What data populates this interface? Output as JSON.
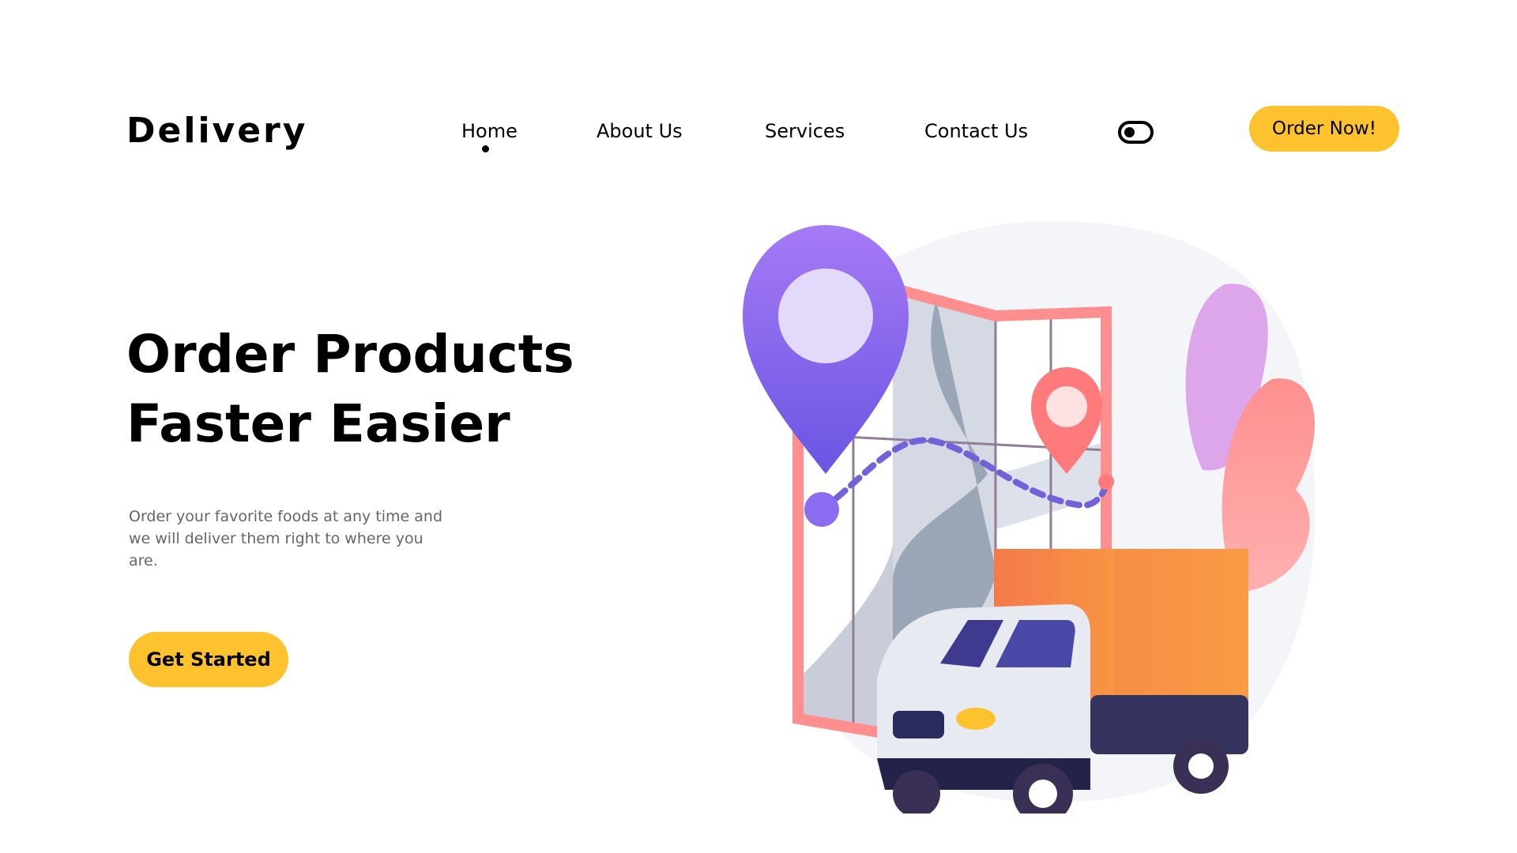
{
  "brand": {
    "logo_text": "Delivery"
  },
  "nav": {
    "items": [
      {
        "label": "Home",
        "active": true
      },
      {
        "label": "About Us",
        "active": false
      },
      {
        "label": "Services",
        "active": false
      },
      {
        "label": "Contact Us",
        "active": false
      }
    ],
    "theme_toggle_icon": "toggle-switch-icon",
    "cta_label": "Order Now!"
  },
  "hero": {
    "title_line1": "Order Products",
    "title_line2": "Faster Easier",
    "description": "Order your favorite foods at any time and we will deliver them right to where you are.",
    "cta_label": "Get Started"
  },
  "illustration": {
    "name": "delivery-truck-map-illustration"
  },
  "colors": {
    "accent": "#fdc22d",
    "text_primary": "#000000",
    "text_secondary": "#666666",
    "pin_purple": "#8b6cf0",
    "pin_coral": "#ff7a7a",
    "truck_orange": "#f6884a"
  }
}
